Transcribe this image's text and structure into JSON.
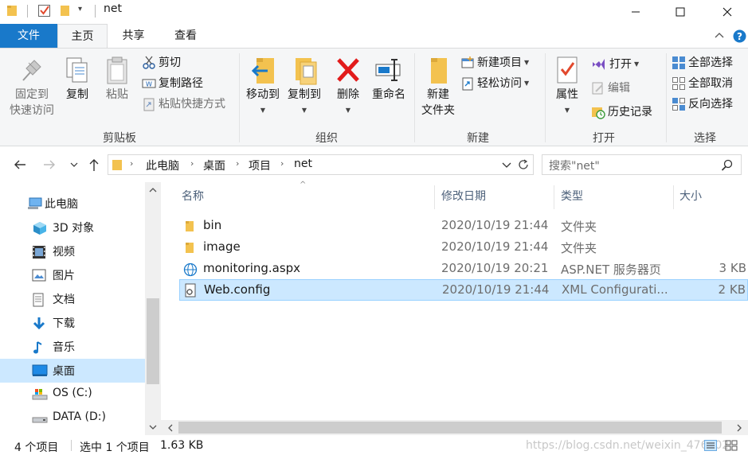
{
  "window": {
    "title": "net",
    "controls": [
      "minimize",
      "maximize",
      "close"
    ]
  },
  "ribbon_tabs": [
    "文件",
    "主页",
    "共享",
    "查看"
  ],
  "ribbon": {
    "clipboard": {
      "label": "剪贴板",
      "pin_line1": "固定到",
      "pin_line2": "快速访问",
      "copy": "复制",
      "paste": "粘贴",
      "cut": "剪切",
      "copy_path": "复制路径",
      "paste_shortcut": "粘贴快捷方式"
    },
    "organize": {
      "label": "组织",
      "move_to": "移动到",
      "copy_to": "复制到",
      "delete": "删除",
      "rename": "重命名"
    },
    "new": {
      "label": "新建",
      "new_folder_line1": "新建",
      "new_folder_line2": "文件夹",
      "new_item": "新建项目",
      "easy_access": "轻松访问"
    },
    "open": {
      "label": "打开",
      "properties": "属性",
      "open": "打开",
      "edit": "编辑",
      "history": "历史记录"
    },
    "select": {
      "label": "选择",
      "select_all": "全部选择",
      "select_none": "全部取消",
      "invert": "反向选择"
    }
  },
  "address": {
    "crumbs": [
      "此电脑",
      "桌面",
      "项目",
      "net"
    ],
    "search_placeholder": "搜索\"net\""
  },
  "nav": {
    "items": [
      {
        "label": "此电脑",
        "icon": "pc-icon"
      },
      {
        "label": "3D 对象",
        "icon": "3d-objects-icon"
      },
      {
        "label": "视频",
        "icon": "video-icon"
      },
      {
        "label": "图片",
        "icon": "pictures-icon"
      },
      {
        "label": "文档",
        "icon": "documents-icon"
      },
      {
        "label": "下载",
        "icon": "download-icon"
      },
      {
        "label": "音乐",
        "icon": "music-icon"
      },
      {
        "label": "桌面",
        "icon": "desktop-icon",
        "selected": true
      },
      {
        "label": "OS (C:)",
        "icon": "drive-icon"
      },
      {
        "label": "DATA (D:)",
        "icon": "drive-icon"
      }
    ]
  },
  "columns": {
    "name": "名称",
    "date": "修改日期",
    "type": "类型",
    "size": "大小"
  },
  "files": [
    {
      "name": "bin",
      "date": "2020/10/19 21:44",
      "type": "文件夹",
      "size": "",
      "icon": "folder-icon"
    },
    {
      "name": "image",
      "date": "2020/10/19 21:44",
      "type": "文件夹",
      "size": "",
      "icon": "folder-icon"
    },
    {
      "name": "monitoring.aspx",
      "date": "2020/10/19 20:21",
      "type": "ASP.NET 服务器页",
      "size": "3 KB",
      "icon": "aspx-icon"
    },
    {
      "name": "Web.config",
      "date": "2020/10/19 21:44",
      "type": "XML Configurati...",
      "size": "2 KB",
      "icon": "config-icon",
      "selected": true
    }
  ],
  "status": {
    "count": "4 个项目",
    "selected": "选中 1 个项目",
    "selected_size": "1.63 KB",
    "watermark": "https://blog.csdn.net/weixin_476002"
  },
  "colors": {
    "accent": "#1979ca",
    "selection": "#cce8ff",
    "folder": "#f3c24f",
    "delete_red": "#e21b1b"
  }
}
